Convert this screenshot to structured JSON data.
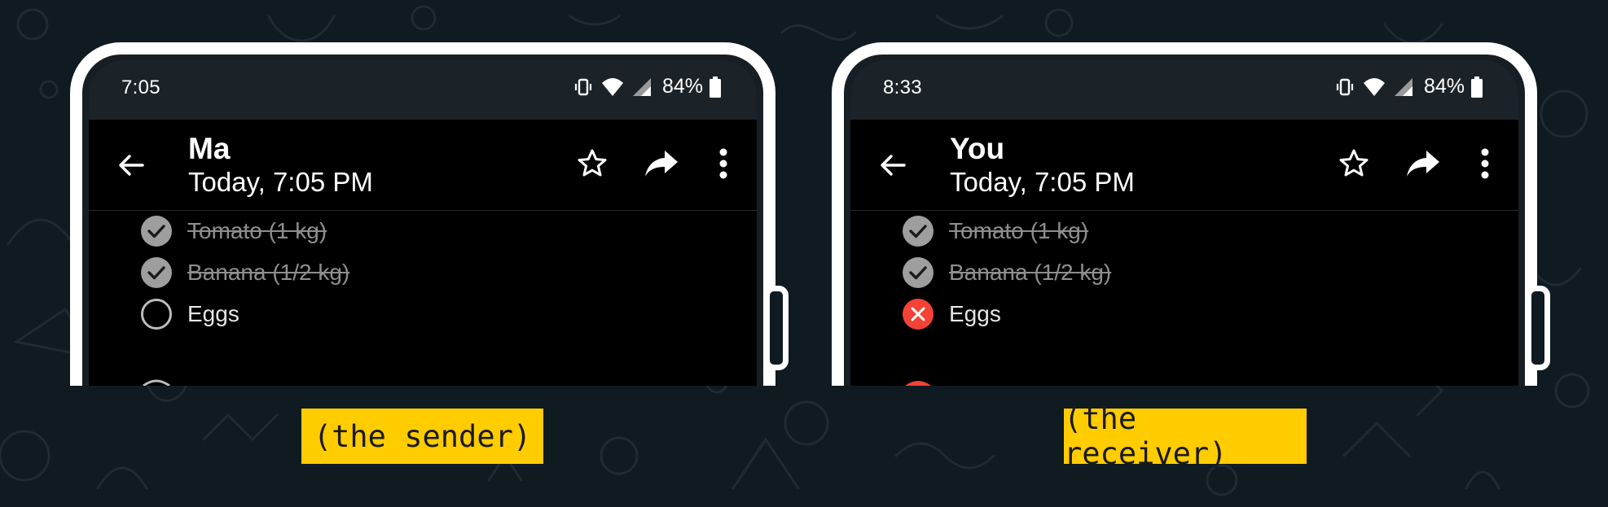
{
  "colors": {
    "background": "#0f1a21",
    "checked": "#9e9e9e",
    "crossed": "#f44336",
    "caption_bg": "#ffcc00"
  },
  "phones": [
    {
      "status_time": "7:05",
      "battery": "84%",
      "contact": "Ma",
      "timestamp": "Today, 7:05 PM",
      "items": [
        {
          "label": "Tomato (1 kg)",
          "state": "checked"
        },
        {
          "label": "Banana (1/2 kg)",
          "state": "checked"
        },
        {
          "label": "Eggs",
          "state": "unchecked"
        }
      ],
      "caption": "(the sender)"
    },
    {
      "status_time": "8:33",
      "battery": "84%",
      "contact": "You",
      "timestamp": "Today, 7:05 PM",
      "items": [
        {
          "label": "Tomato (1 kg)",
          "state": "checked"
        },
        {
          "label": "Banana (1/2 kg)",
          "state": "checked"
        },
        {
          "label": "Eggs",
          "state": "crossed"
        }
      ],
      "caption": "(the receiver)"
    }
  ],
  "icons": [
    "back-arrow-icon",
    "star-icon",
    "forward-icon",
    "more-vert-icon",
    "vibrate-icon",
    "wifi-icon",
    "signal-icon",
    "battery-icon",
    "check-circle-icon",
    "empty-circle-icon",
    "cross-circle-icon"
  ]
}
